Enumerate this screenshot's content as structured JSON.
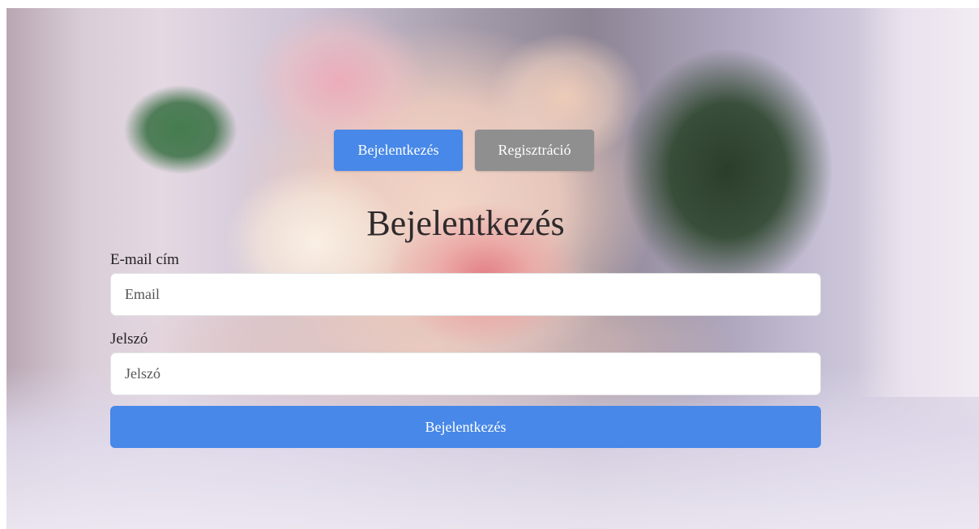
{
  "tabs": {
    "login_label": "Bejelentkezés",
    "register_label": "Regisztráció"
  },
  "form": {
    "title": "Bejelentkezés",
    "email": {
      "label": "E-mail cím",
      "value": "",
      "placeholder": "Email"
    },
    "password": {
      "label": "Jelszó",
      "value": "",
      "placeholder": "Jelszó"
    },
    "submit_label": "Bejelentkezés"
  },
  "colors": {
    "primary": "#4788e8",
    "secondary": "#8f8f8f",
    "title_text": "#2e2a2c"
  }
}
